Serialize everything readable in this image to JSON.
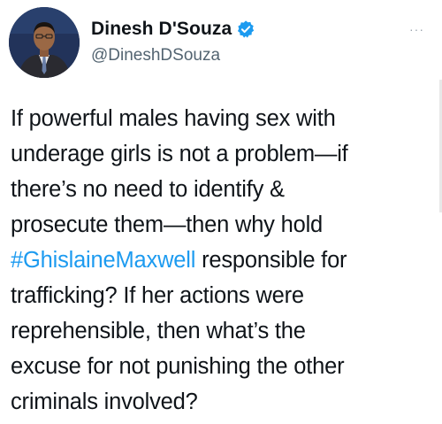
{
  "author": {
    "display_name": "Dinesh D'Souza",
    "handle": "@DineshDSouza",
    "verified_icon": "verified-badge-icon"
  },
  "more_icon": "more-options-icon",
  "more_glyph": "···",
  "tweet": {
    "line1": "If powerful males having sex with",
    "line2": "underage girls is not a problem—if",
    "line3": "there’s no need to identify &",
    "line4": "prosecute them—then why hold",
    "hashtag": "#GhislaineMaxwell",
    "line5_rest": " responsible for",
    "line6": "trafficking? If her actions were",
    "line7": "reprehensible, then what’s the",
    "line8": "excuse for not punishing the other",
    "line9": "criminals involved?"
  },
  "colors": {
    "verified": "#1d9bf0",
    "hashtag": "#1d9bf0",
    "text": "#0f1419",
    "secondary": "#536471"
  }
}
